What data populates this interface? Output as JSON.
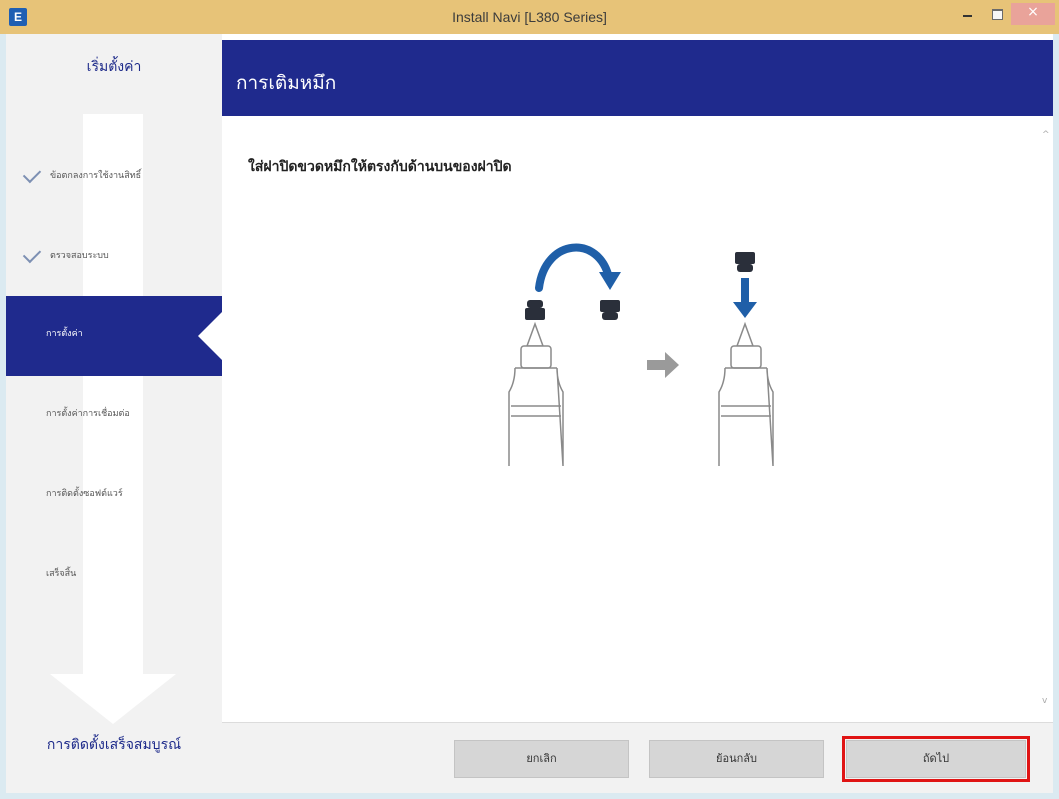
{
  "window": {
    "title": "Install Navi [L380 Series]",
    "icon": "E",
    "icon_name": "epson-app-icon"
  },
  "colors": {
    "accent": "#1f2a8d",
    "titlebar": "#e7c378",
    "highlight_border": "#e01414",
    "illustration_blue": "#1f5fa8"
  },
  "sidebar": {
    "title": "เริ่มตั้งค่า",
    "footer": "การติดตั้งเสร็จสมบูรณ์",
    "steps": [
      {
        "label": "ข้อตกลงการใช้งานสิทธิ์",
        "state": "done"
      },
      {
        "label": "ตรวจสอบระบบ",
        "state": "done"
      },
      {
        "label": "การตั้งค่า",
        "state": "active"
      },
      {
        "label": "การตั้งค่าการเชื่อมต่อ",
        "state": "pending"
      },
      {
        "label": "การติดตั้งซอฟต์แวร์",
        "state": "pending"
      },
      {
        "label": "เสร็จสิ้น",
        "state": "pending"
      }
    ]
  },
  "header": {
    "title": "การเติมหมึก"
  },
  "content": {
    "instruction": "ใส่ฝาปิดขวดหมึกให้ตรงกับด้านบนของฝาปิด"
  },
  "buttons": {
    "cancel": "ยกเลิก",
    "back": "ย้อนกลับ",
    "next": "ถัดไป"
  }
}
